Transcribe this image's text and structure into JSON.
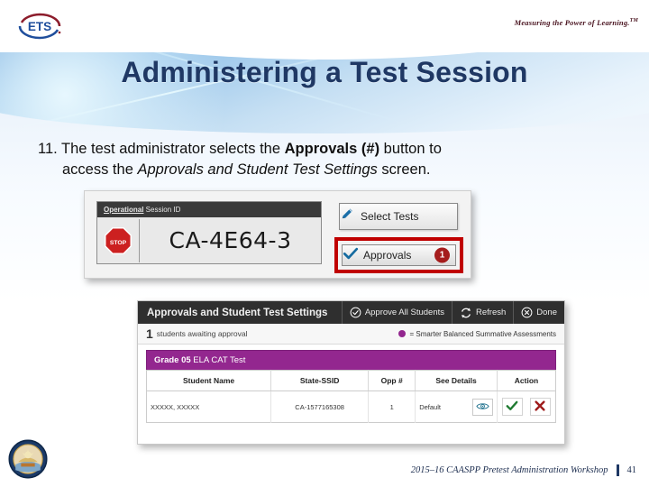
{
  "header": {
    "logo_alt": "ETS",
    "tagline": "Measuring the Power of Learning.",
    "tagline_tm": "TM"
  },
  "title": "Administering a Test Session",
  "bullet": {
    "number": "11.",
    "line1_a": "The test administrator selects the ",
    "line1_bold": "Approvals (#)",
    "line1_b": " button to",
    "line2_a": "access the ",
    "line2_italic": "Approvals and Student Test Settings",
    "line2_b": " screen."
  },
  "session_panel": {
    "head_underlined": "Operational",
    "head_rest": " Session ID",
    "stop_label": "STOP",
    "session_id": "CA-4E64-3",
    "select_tests_label": "Select Tests",
    "approvals_label": "Approvals",
    "approvals_badge": "1",
    "highlight_color": "#c00000"
  },
  "approvals_screen": {
    "title": "Approvals and Student Test Settings",
    "actions": [
      {
        "label": "Approve All Students",
        "icon": "check-circle-icon"
      },
      {
        "label": "Refresh",
        "icon": "refresh-icon"
      },
      {
        "label": "Done",
        "icon": "close-circle-icon"
      }
    ],
    "awaiting_count": "1",
    "awaiting_text": "students awaiting approval",
    "legend": "= Smarter Balanced Summative Assessments",
    "legend_color": "#93278f",
    "group_label_bold": "Grade 05",
    "group_label_rest": " ELA CAT Test",
    "columns": [
      "Student Name",
      "State-SSID",
      "Opp #",
      "See Details",
      "Action"
    ],
    "rows": [
      {
        "student_name": "XXXXX, XXXXX",
        "state_ssid": "CA-1577165308",
        "opp": "1",
        "details": "Default",
        "approve_icon": "check-icon",
        "deny_icon": "x-icon"
      }
    ]
  },
  "footer": {
    "text": "2015–16 CAASPP Pretest Administration Workshop",
    "page": "41"
  }
}
